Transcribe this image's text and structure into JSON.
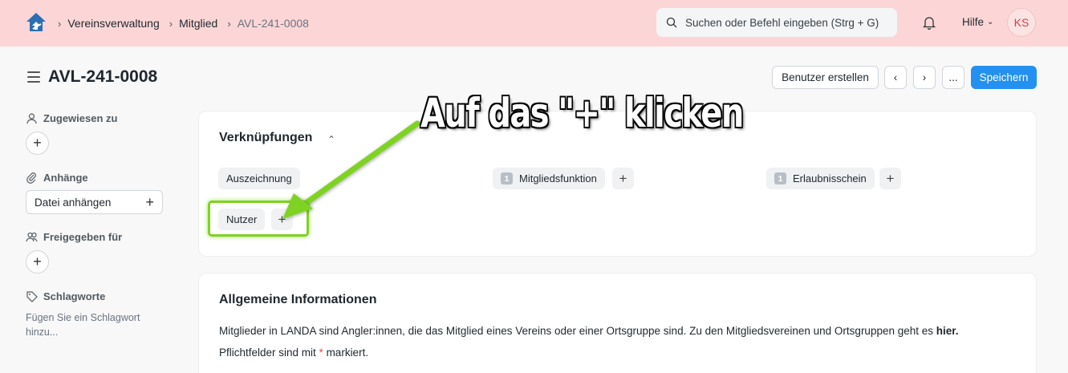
{
  "navbar": {
    "breadcrumbs": [
      "Vereinsverwaltung",
      "Mitglied",
      "AVL-241-0008"
    ],
    "search_placeholder": "Suchen oder Befehl eingeben (Strg + G)",
    "help_label": "Hilfe",
    "avatar_initials": "KS"
  },
  "header": {
    "title": "AVL-241-0008",
    "create_user_label": "Benutzer erstellen",
    "more_label": "...",
    "save_label": "Speichern"
  },
  "sidebar": {
    "assigned_label": "Zugewiesen zu",
    "attachments_label": "Anhänge",
    "attach_file_label": "Datei anhängen",
    "shared_label": "Freigegeben für",
    "tags_label": "Schlagworte",
    "tags_hint": "Fügen Sie ein Schlagwort hinzu..."
  },
  "links_card": {
    "title": "Verknüpfungen",
    "items": [
      {
        "label": "Auszeichnung",
        "count": null
      },
      {
        "label": "Mitgliedsfunktion",
        "count": "1"
      },
      {
        "label": "Erlaubnisschein",
        "count": "1"
      },
      {
        "label": "Nutzer",
        "count": null
      }
    ]
  },
  "info_card": {
    "title": "Allgemeine Informationen",
    "line1_prefix": "Mitglieder in LANDA sind Angler:innen, die das Mitglied eines Vereins oder einer Ortsgruppe sind. Zu den Mitgliedsvereinen und Ortsgruppen geht es ",
    "line1_link": "hier.",
    "line2_prefix": "Pflichtfelder sind mit ",
    "line2_star": "*",
    "line2_suffix": " markiert."
  },
  "annotation": {
    "text": "Auf das \"+\" klicken",
    "color": "#7ed321"
  },
  "colors": {
    "navbar_bg": "#fcd6d6",
    "primary": "#2490ef",
    "highlight": "#7ed321"
  }
}
